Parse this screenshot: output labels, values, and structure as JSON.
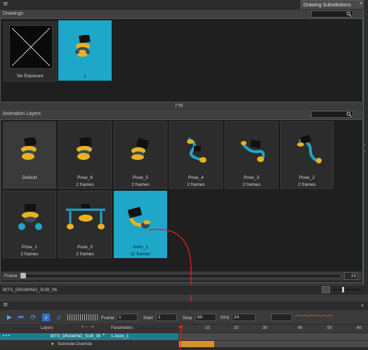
{
  "panel": {
    "tab_title": "Drawing Substitutions",
    "tab_close": "×",
    "menu_icon": "≡"
  },
  "drawings": {
    "section_title": "Drawings",
    "items": [
      {
        "label": "No Exposure",
        "selected": false,
        "icon": "no-exposure-icon"
      },
      {
        "label": "1",
        "selected": true,
        "icon": "drawing-thumbnail-icon"
      }
    ]
  },
  "splitter": {
    "arrows": "|^|v|"
  },
  "animation_layers": {
    "section_title": "Animation Layers",
    "items": [
      {
        "name": "Default",
        "frames": ""
      },
      {
        "name": "Pose_6",
        "frames": "2 frames"
      },
      {
        "name": "Pose_5",
        "frames": "2 frames"
      },
      {
        "name": "Pose_4",
        "frames": "2 frames"
      },
      {
        "name": "Pose_3",
        "frames": "2 frames"
      },
      {
        "name": "Pose_2",
        "frames": "2 frames"
      },
      {
        "name": "Pose_1",
        "frames": "2 frames"
      },
      {
        "name": "Pose_0",
        "frames": "2 frames"
      },
      {
        "name": "Anim_1",
        "frames": "11 frames",
        "selected": true
      }
    ],
    "frame_label": "Frame",
    "frame_value": "15",
    "frame_position": 0.0
  },
  "bottom_bar": {
    "node_name": "BITS_DRAWING_SUB_06"
  },
  "timeline": {
    "menu_icon": "≡",
    "close": "×",
    "frame_label": "Frame",
    "frame_value": "1",
    "start_label": "Start",
    "start_value": "1",
    "stop_label": "Stop",
    "stop_value": "60",
    "fps_label": "FPS",
    "fps_value": "24",
    "layers_header": "Layers",
    "parameters_header": "Parameters",
    "rows": [
      {
        "layer": "BITS_DRAWING_SUB_06",
        "parameter": "1:Anim_1"
      },
      {
        "layer": "Subnode-Override",
        "parameter": ""
      }
    ],
    "ruler": [
      "10",
      "20",
      "30",
      "40",
      "50",
      "60"
    ]
  },
  "colors": {
    "accent": "#1ea7c9",
    "panel_bg": "#1f1f1f",
    "playhead": "#e02020",
    "exposure": "#d4922a"
  }
}
